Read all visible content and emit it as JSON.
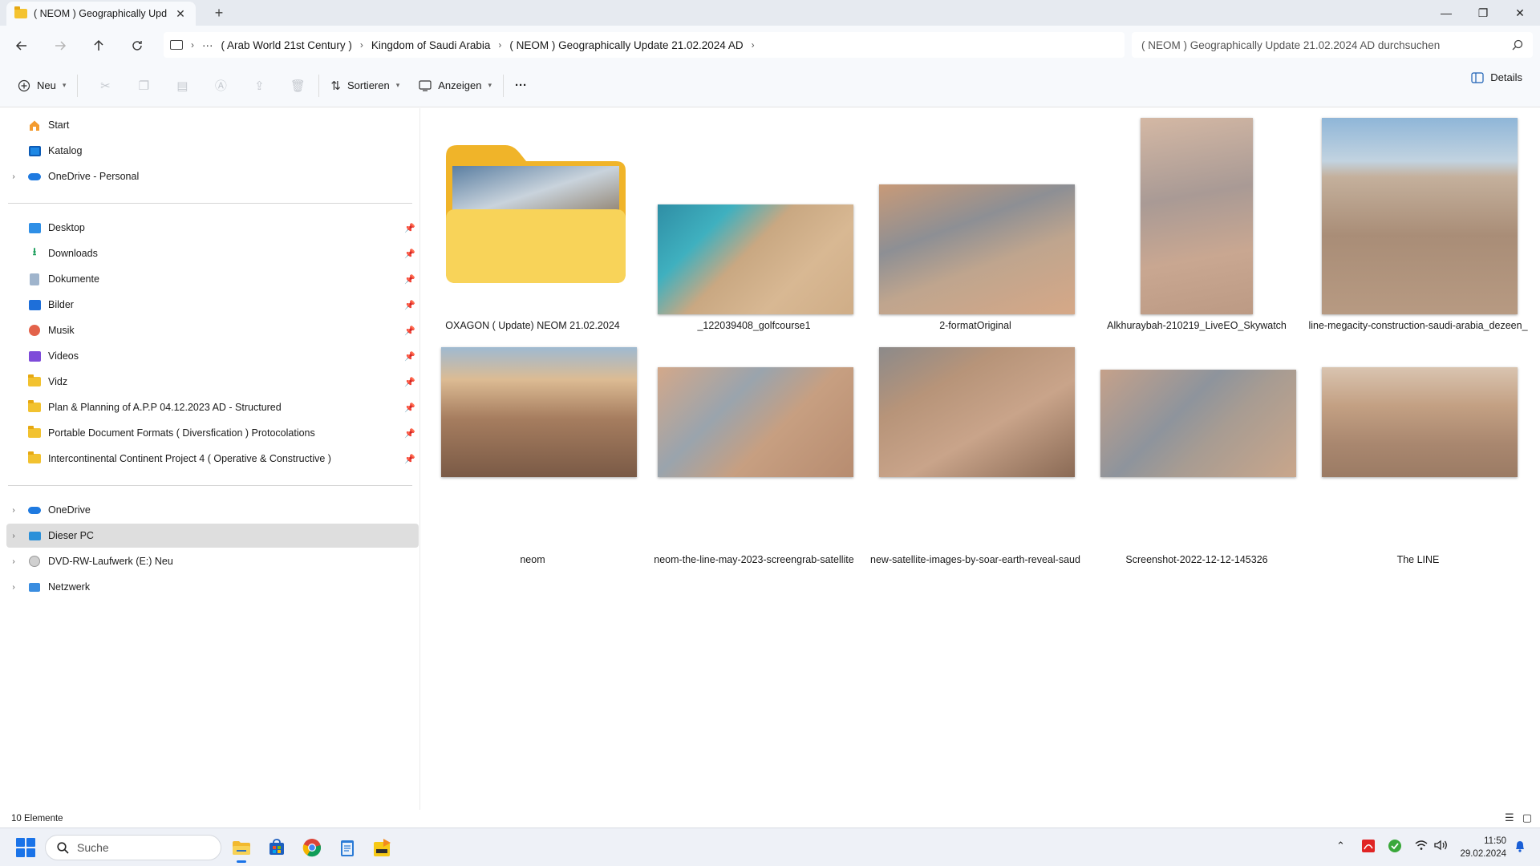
{
  "window": {
    "tab_title": "( NEOM ) Geographically Upda",
    "tab_close": "✕",
    "new_tab": "+",
    "minimize": "—",
    "maximize": "❐",
    "close": "✕"
  },
  "address": {
    "overflow": "···",
    "crumbs": [
      "( Arab World 21st Century )",
      "Kingdom of Saudi Arabia",
      "( NEOM ) Geographically Update 21.02.2024 AD"
    ],
    "search_placeholder": "( NEOM ) Geographically Update 21.02.2024 AD durchsuchen"
  },
  "toolbar": {
    "new_label": "Neu",
    "sort_label": "Sortieren",
    "view_label": "Anzeigen",
    "more_label": "···",
    "details_label": "Details"
  },
  "sidebar": {
    "top": [
      {
        "label": "Start",
        "icon": "home-icon"
      },
      {
        "label": "Katalog",
        "icon": "gallery-icon"
      },
      {
        "label": "OneDrive - Personal",
        "icon": "onedrive-icon"
      }
    ],
    "pinned": [
      {
        "label": "Desktop",
        "icon": "desktop-icon"
      },
      {
        "label": "Downloads",
        "icon": "download-icon"
      },
      {
        "label": "Dokumente",
        "icon": "documents-icon"
      },
      {
        "label": "Bilder",
        "icon": "pictures-icon"
      },
      {
        "label": "Musik",
        "icon": "music-icon"
      },
      {
        "label": "Videos",
        "icon": "videos-icon"
      },
      {
        "label": "Vidz",
        "icon": "folder-icon"
      },
      {
        "label": "Plan  & Planning of A.P.P 04.12.2023 AD - Structured",
        "icon": "folder-icon"
      },
      {
        "label": "Portable Document Formats ( Diversfication ) Protocolations",
        "icon": "folder-icon"
      },
      {
        "label": "Intercontinental Continent Project 4 ( Operative & Constructive )",
        "icon": "folder-icon"
      }
    ],
    "bottom": [
      {
        "label": "OneDrive",
        "icon": "onedrive-icon"
      },
      {
        "label": "Dieser PC",
        "icon": "pc-icon"
      },
      {
        "label": "DVD-RW-Laufwerk (E:) Neu",
        "icon": "dvd-icon"
      },
      {
        "label": "Netzwerk",
        "icon": "network-icon"
      }
    ]
  },
  "files": [
    {
      "name": "OXAGON ( Update) NEOM 21.02.2024",
      "type": "folder"
    },
    {
      "name": "_122039408_golfcourse1",
      "type": "image"
    },
    {
      "name": "2-formatOriginal",
      "type": "image"
    },
    {
      "name": "Alkhuraybah-210219_LiveEO_Skywatch",
      "type": "image"
    },
    {
      "name": "line-megacity-construction-saudi-arabia_dezeen_",
      "type": "image"
    },
    {
      "name": "neom",
      "type": "image"
    },
    {
      "name": "neom-the-line-may-2023-screengrab-satellite",
      "type": "image"
    },
    {
      "name": "new-satellite-images-by-soar-earth-reveal-saud",
      "type": "image"
    },
    {
      "name": "Screenshot-2022-12-12-145326",
      "type": "image"
    },
    {
      "name": "The LINE",
      "type": "image"
    }
  ],
  "status": {
    "count": "10 Elemente"
  },
  "taskbar": {
    "search_label": "Suche",
    "time": "11:50",
    "date": "29.02.2024"
  },
  "colors": {
    "accent": "#1a73e8",
    "folder": "#f2c230",
    "selected": "#dedede"
  }
}
